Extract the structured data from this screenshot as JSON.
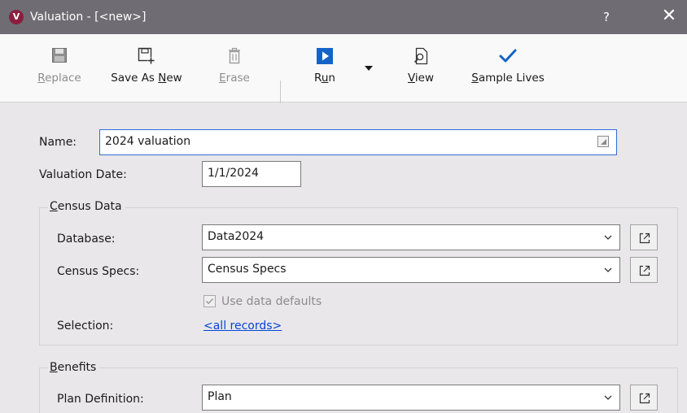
{
  "window": {
    "title": "Valuation - [<new>]",
    "app_icon_letter": "V",
    "help_label": "?",
    "close_label": "✕"
  },
  "toolbar": {
    "replace": {
      "pre": "",
      "key": "R",
      "post": "eplace",
      "enabled": false,
      "icon": "floppy-disk-icon"
    },
    "save_as_new": {
      "pre": "Save As ",
      "key": "N",
      "post": "ew",
      "enabled": true,
      "icon": "save-as-new-icon"
    },
    "erase": {
      "pre": "",
      "key": "E",
      "post": "rase",
      "enabled": false,
      "icon": "trash-icon"
    },
    "run": {
      "pre": "R",
      "key": "u",
      "post": "n",
      "enabled": true,
      "icon": "play-icon"
    },
    "view": {
      "pre": "",
      "key": "V",
      "post": "iew",
      "enabled": true,
      "icon": "view-document-icon"
    },
    "sample_lives": {
      "pre": "",
      "key": "S",
      "post": "ample Lives",
      "enabled": true,
      "icon": "checkmark-icon"
    }
  },
  "form": {
    "name_label": "Name:",
    "name_value": "2024 valuation",
    "valuation_date_label": "Valuation Date:",
    "valuation_date_value": "1/1/2024",
    "census_group": {
      "key": "C",
      "post": "ensus Data"
    },
    "database_label": "Database:",
    "database_value": "Data2024",
    "census_specs_label": "Census Specs:",
    "census_specs_value": "Census Specs",
    "use_data_defaults": {
      "label": "Use data defaults",
      "checked": true,
      "enabled": false
    },
    "selection_label": "Selection:",
    "selection_link": "<all records>",
    "benefits_group": {
      "key": "B",
      "post": "enefits"
    },
    "plan_definition_label": "Plan Definition:",
    "plan_definition_value": "Plan"
  },
  "colors": {
    "titlebar": "#6f6d73",
    "app_icon": "#8b1e3f",
    "accent_blue": "#1464c8",
    "link": "#0645d6",
    "focus_border": "#2f6fd6"
  }
}
